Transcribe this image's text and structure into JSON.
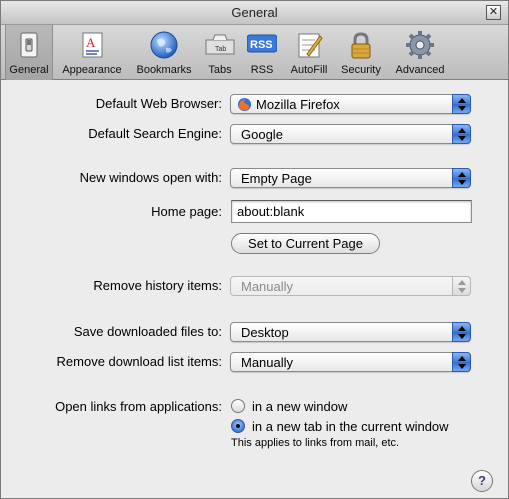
{
  "window": {
    "title": "General",
    "close_glyph": "✕"
  },
  "toolbar": {
    "items": [
      {
        "label": "General",
        "icon": "switch-icon",
        "selected": true
      },
      {
        "label": "Appearance",
        "icon": "font-document-icon",
        "selected": false
      },
      {
        "label": "Bookmarks",
        "icon": "globe-icon",
        "selected": false
      },
      {
        "label": "Tabs",
        "icon": "tab-icon",
        "selected": false,
        "icon_text": "Tab"
      },
      {
        "label": "RSS",
        "icon": "rss-icon",
        "selected": false,
        "icon_text": "RSS"
      },
      {
        "label": "AutoFill",
        "icon": "pencil-form-icon",
        "selected": false
      },
      {
        "label": "Security",
        "icon": "padlock-icon",
        "selected": false
      },
      {
        "label": "Advanced",
        "icon": "gear-icon",
        "selected": false
      }
    ]
  },
  "form": {
    "default_browser": {
      "label": "Default Web Browser:",
      "value": "Mozilla Firefox",
      "icon": "firefox-icon"
    },
    "default_search": {
      "label": "Default Search Engine:",
      "value": "Google"
    },
    "new_windows": {
      "label": "New windows open with:",
      "value": "Empty Page"
    },
    "home_page": {
      "label": "Home page:",
      "value": "about:blank"
    },
    "set_current_button": "Set to Current Page",
    "remove_history": {
      "label": "Remove history items:",
      "value": "Manually",
      "disabled": true
    },
    "save_downloads": {
      "label": "Save downloaded files to:",
      "value": "Desktop"
    },
    "remove_download_list": {
      "label": "Remove download list items:",
      "value": "Manually"
    },
    "open_links": {
      "label": "Open links from applications:",
      "options": [
        {
          "label": "in a new window",
          "selected": false
        },
        {
          "label": "in a new tab in the current window",
          "selected": true
        }
      ],
      "note": "This applies to links from mail, etc."
    }
  },
  "help_glyph": "?",
  "colors": {
    "accent": "#3d7ad9",
    "window_bg": "#ececec"
  }
}
